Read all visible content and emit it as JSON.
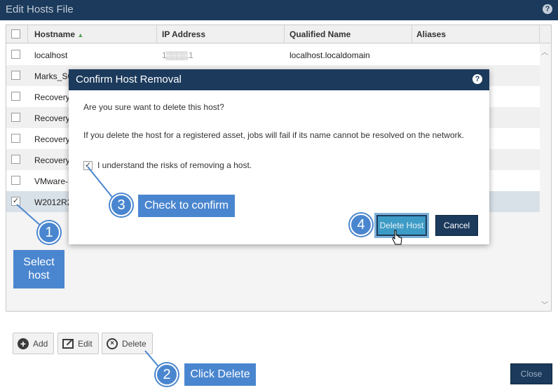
{
  "window": {
    "title": "Edit Hosts File",
    "help": "?"
  },
  "grid": {
    "columns": [
      "Hostname",
      "IP Address",
      "Qualified Name",
      "Aliases"
    ],
    "sort_indicator": "▲",
    "rows": [
      {
        "hostname": "localhost",
        "ip": "1▒▒▒▒.1",
        "qualified": "localhost.localdomain",
        "checked": false
      },
      {
        "hostname": "Marks_SC",
        "ip": "",
        "qualified": "",
        "checked": false
      },
      {
        "hostname": "Recovery",
        "ip": "",
        "qualified": "",
        "checked": false
      },
      {
        "hostname": "Recovery",
        "ip": "",
        "qualified": "",
        "checked": false
      },
      {
        "hostname": "Recovery",
        "ip": "",
        "qualified": "",
        "checked": false
      },
      {
        "hostname": "Recovery",
        "ip": "",
        "qualified": "",
        "checked": false
      },
      {
        "hostname": "VMware-",
        "ip": "",
        "qualified": "",
        "checked": false
      },
      {
        "hostname": "W2012R2",
        "ip": "",
        "qualified": "",
        "checked": true
      }
    ]
  },
  "toolbar": {
    "add_label": "Add",
    "edit_label": "Edit",
    "delete_label": "Delete"
  },
  "close_label": "Close",
  "dialog": {
    "title": "Confirm Host Removal",
    "help": "?",
    "question": "Are you sure want to delete this host?",
    "warning": "If you delete the host for a registered asset, jobs will fail if its name cannot be resolved on the network.",
    "checkbox_label": "I understand the risks of removing a host.",
    "checkbox_checked": true,
    "delete_label": "Delete Host",
    "cancel_label": "Cancel"
  },
  "callouts": [
    {
      "number": "1",
      "label_line1": "Select",
      "label_line2": "host"
    },
    {
      "number": "2",
      "label": "Click Delete"
    },
    {
      "number": "3",
      "label": "Check to confirm"
    },
    {
      "number": "4"
    }
  ],
  "colors": {
    "header": "#1b3a5c",
    "callout": "#4a86cf",
    "selected_row": "#d9e1e8",
    "accent_button": "#3d9cc6"
  }
}
